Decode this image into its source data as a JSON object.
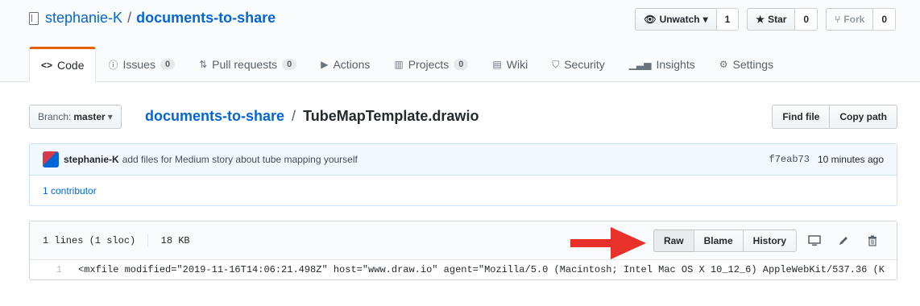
{
  "repo": {
    "owner": "stephanie-K",
    "separator": "/",
    "name": "documents-to-share"
  },
  "actions": {
    "watch": {
      "label": "Unwatch",
      "count": "1"
    },
    "star": {
      "label": "Star",
      "count": "0"
    },
    "fork": {
      "label": "Fork",
      "count": "0"
    }
  },
  "tabs": [
    {
      "label": "Code",
      "icon": "<>"
    },
    {
      "label": "Issues",
      "count": "0"
    },
    {
      "label": "Pull requests",
      "count": "0"
    },
    {
      "label": "Actions"
    },
    {
      "label": "Projects",
      "count": "0"
    },
    {
      "label": "Wiki"
    },
    {
      "label": "Security"
    },
    {
      "label": "Insights"
    },
    {
      "label": "Settings"
    }
  ],
  "branch": {
    "prefix": "Branch:",
    "name": "master"
  },
  "breadcrumb": {
    "repo": "documents-to-share",
    "slash": "/",
    "file": "TubeMapTemplate.drawio"
  },
  "path_buttons": {
    "find": "Find file",
    "copy": "Copy path"
  },
  "commit": {
    "author": "stephanie-K",
    "message": "add files for Medium story about tube mapping yourself",
    "sha": "f7eab73",
    "time": "10 minutes ago"
  },
  "contributors": "1 contributor",
  "file": {
    "lines": "1 lines (1 sloc)",
    "size": "18 KB",
    "buttons": {
      "raw": "Raw",
      "blame": "Blame",
      "history": "History"
    },
    "line_number": "1",
    "code": "<mxfile modified=\"2019-11-16T14:06:21.498Z\" host=\"www.draw.io\" agent=\"Mozilla/5.0 (Macintosh; Intel Mac OS X 10_12_6) AppleWebKit/537.36 (K"
  },
  "colors": {
    "link": "#0366d6",
    "arrow": "#e8312a",
    "tab_accent": "#e36209"
  }
}
